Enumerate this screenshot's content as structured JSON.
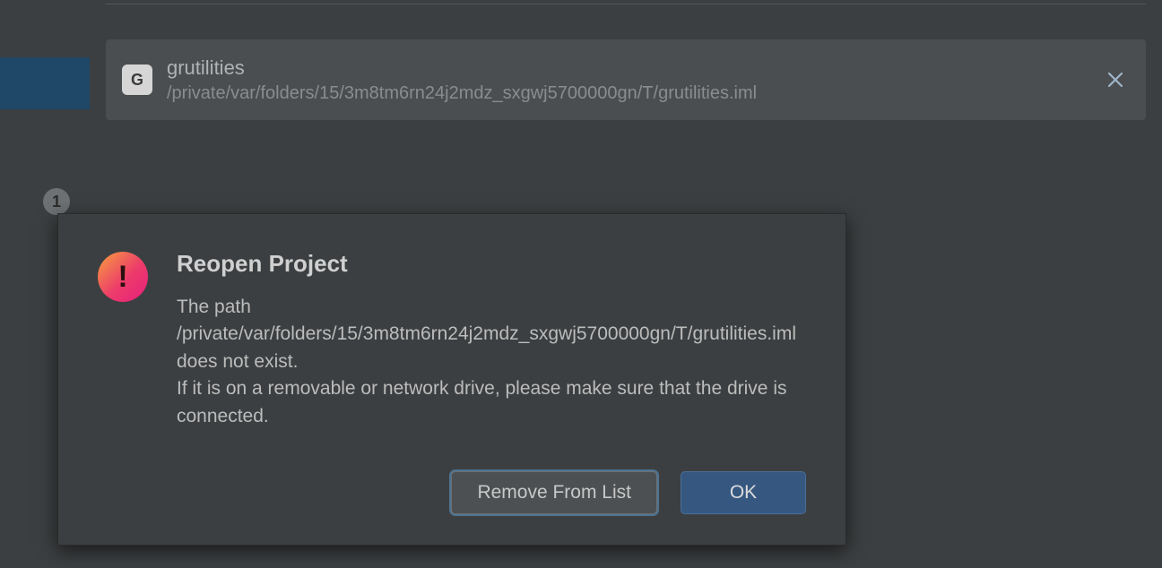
{
  "sidebar": {
    "badge_count": "1"
  },
  "project_row": {
    "initial": "G",
    "name": "grutilities",
    "path": "/private/var/folders/15/3m8tm6rn24j2mdz_sxgwj5700000gn/T/grutilities.iml"
  },
  "dialog": {
    "icon_glyph": "!",
    "title": "Reopen Project",
    "message": "The path\n/private/var/folders/15/3m8tm6rn24j2mdz_sxgwj5700000gn/T/grutilities.iml dоes not exist.\nIf it is on a removable or network drive, please make sure that the drive is connected.",
    "remove_label": "Remove From List",
    "ok_label": "OK"
  }
}
